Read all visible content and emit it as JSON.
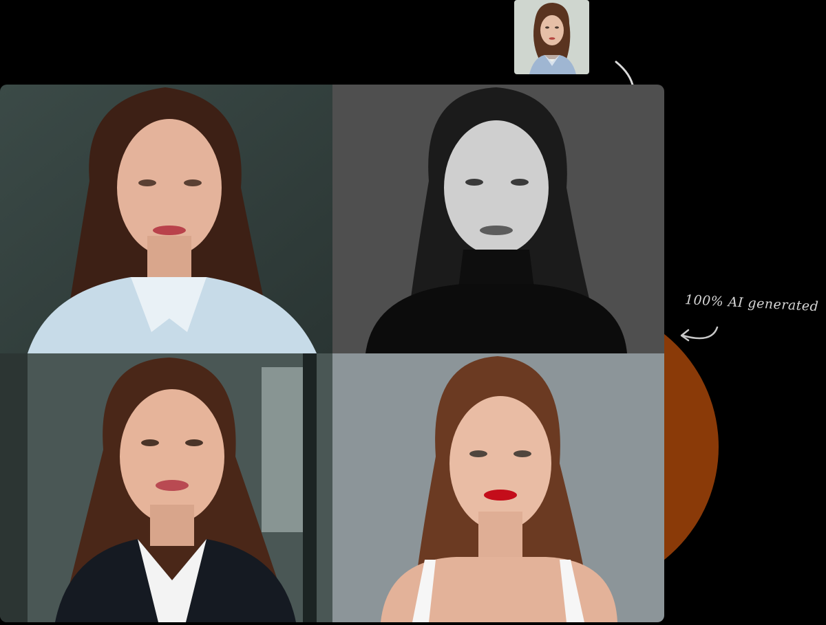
{
  "caption": {
    "text": "100% AI generated"
  },
  "colors": {
    "background": "#000000",
    "accent_disc": "#8a3a08",
    "annotation_stroke": "#d9d9d9"
  },
  "reference_photo": {
    "icon": "portrait-reference-photo"
  },
  "tiles": [
    {
      "icon": "portrait-light-blue-shirt-photo"
    },
    {
      "icon": "portrait-black-white-turtleneck-photo"
    },
    {
      "icon": "portrait-office-blazer-photo"
    },
    {
      "icon": "portrait-white-top-red-lips-photo"
    }
  ]
}
